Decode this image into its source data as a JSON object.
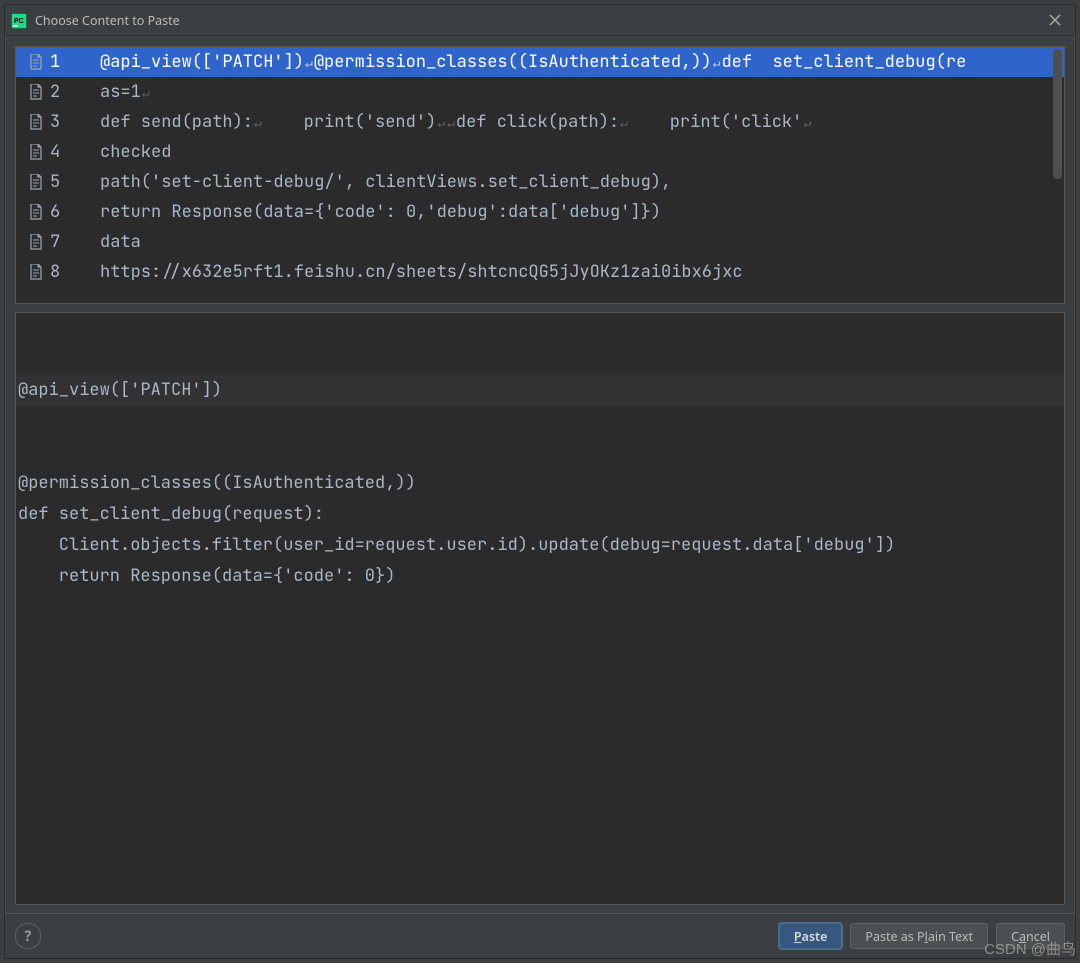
{
  "window": {
    "title": "Choose Content to Paste",
    "close_tooltip": "Close"
  },
  "clipboard_list": {
    "items": [
      {
        "num": "1",
        "selected": true,
        "segments": [
          {
            "t": "@api_view(['PATCH'])"
          },
          {
            "nl": true
          },
          {
            "t": "@permission_classes((IsAuthenticated,))"
          },
          {
            "nl": true
          },
          {
            "t": "def  set_client_debug(re"
          }
        ]
      },
      {
        "num": "2",
        "segments": [
          {
            "t": "as=1"
          },
          {
            "nl": true
          }
        ]
      },
      {
        "num": "3",
        "segments": [
          {
            "t": "def send(path):"
          },
          {
            "nl": true
          },
          {
            "t": "    print('send')"
          },
          {
            "nl": true
          },
          {
            "nl": true
          },
          {
            "t": "def click(path):"
          },
          {
            "nl": true
          },
          {
            "t": "    print('click'"
          },
          {
            "nl": true
          }
        ]
      },
      {
        "num": "4",
        "segments": [
          {
            "t": "checked"
          }
        ]
      },
      {
        "num": "5",
        "segments": [
          {
            "t": "path('set-client-debug/', clientViews.set_client_debug),"
          }
        ]
      },
      {
        "num": "6",
        "segments": [
          {
            "t": "return Response(data={'code': 0,'debug':data['debug']})"
          }
        ]
      },
      {
        "num": "7",
        "segments": [
          {
            "t": "data"
          }
        ]
      },
      {
        "num": "8",
        "segments": [
          {
            "t": "https://x632e5rft1.feishu.cn/sheets/shtcncQG5jJyOKz1zai0ibx6jxc"
          }
        ]
      }
    ]
  },
  "preview": {
    "line0": "@api_view(['PATCH'])",
    "rest": "@permission_classes((IsAuthenticated,))\ndef set_client_debug(request):\n    Client.objects.filter(user_id=request.user.id).update(debug=request.data['debug'])\n    return Response(data={'code': 0})"
  },
  "buttons": {
    "help_label": "?",
    "paste_pre": "",
    "paste_mnemonic": "P",
    "paste_post": "aste",
    "plain_pre": "Paste as P",
    "plain_mnemonic": "l",
    "plain_post": "ain Text",
    "cancel_pre": "C",
    "cancel_mnemonic": "a",
    "cancel_post": "ncel"
  },
  "watermark": "CSDN @曲鸟"
}
